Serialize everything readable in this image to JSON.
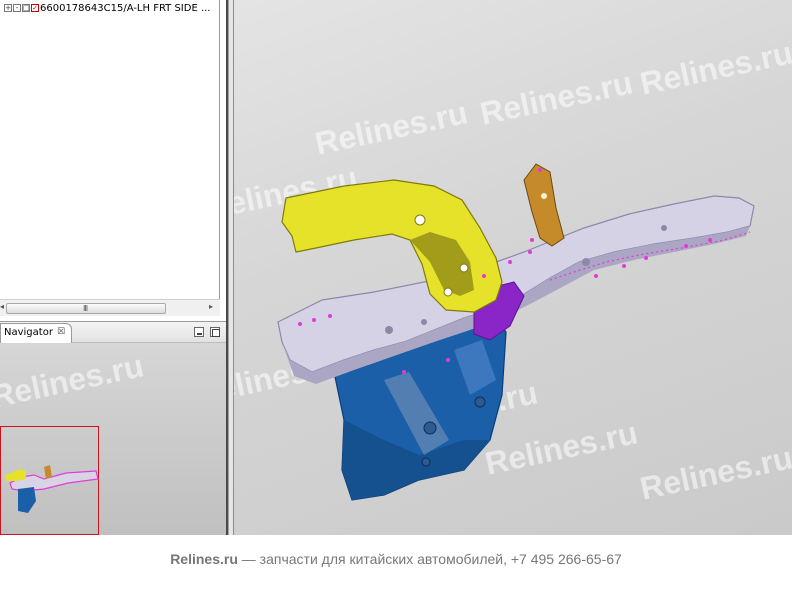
{
  "tree": {
    "item_label": "6600178643C15/A-LH FRT SIDE ..."
  },
  "navigator": {
    "tab_label": "Navigator",
    "close_glyph": "☒"
  },
  "scrollbar": {
    "left_arrow": "◂",
    "grip": "III",
    "right_arrow": "▸"
  },
  "watermark": "Relines.ru",
  "footer": {
    "brand": "Relines.ru",
    "text": "— запчасти для китайских автомобилей, +7 495 266-65-67"
  },
  "part_colors": {
    "rail": "#d6d2e6",
    "bracket": "#e6e22a",
    "housing": "#1b5fa8",
    "gusset": "#8a25c8",
    "mount": "#c58a2a",
    "markers": "#e23bd8"
  }
}
